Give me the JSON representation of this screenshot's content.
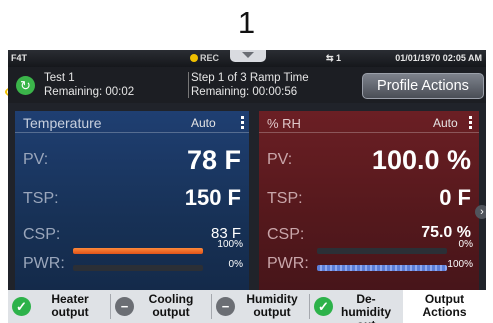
{
  "callout": "1",
  "status": {
    "brand": "F4T",
    "rec": "REC",
    "usb": "⇆ 1",
    "datetime": "01/01/1970 02:05 AM"
  },
  "profile": {
    "icon": "refresh-icon",
    "name": "Test 1",
    "remaining": "Remaining: 00:02",
    "step": "Step 1 of 3 Ramp Time",
    "step_remaining": "Remaining: 00:00:56",
    "actions_label": "Profile Actions"
  },
  "temperature": {
    "title": "Temperature",
    "mode": "Auto",
    "pv_label": "PV:",
    "pv": "78 F",
    "tsp_label": "TSP:",
    "tsp": "150 F",
    "csp_label": "CSP:",
    "csp": "83 F",
    "pwr_label": "PWR:",
    "pwr_top_pct": "100%",
    "pwr_bot_pct": "0%",
    "pwr_top_level": 1.0,
    "pwr_bot_level": 0.0
  },
  "humidity": {
    "title": "% RH",
    "mode": "Auto",
    "pv_label": "PV:",
    "pv": "100.0 %",
    "tsp_label": "TSP:",
    "tsp": "0 F",
    "csp_label": "CSP:",
    "csp": "75.0 %",
    "pwr_label": "PWR:",
    "pwr_top_pct": "0%",
    "pwr_bot_pct": "100%",
    "pwr_top_level": 0.0,
    "pwr_bot_level": 1.0
  },
  "outputs": {
    "heater": "Heater output",
    "cooling": "Cooling output",
    "humidity": "Humidity output",
    "dehumidity": "De-humidity out",
    "actions": "Output Actions"
  },
  "colors": {
    "accent_green": "#2db24a",
    "callout_yellow": "#f2c200",
    "temp_panel": "#1f3f72",
    "rh_panel": "#6b1f24"
  }
}
